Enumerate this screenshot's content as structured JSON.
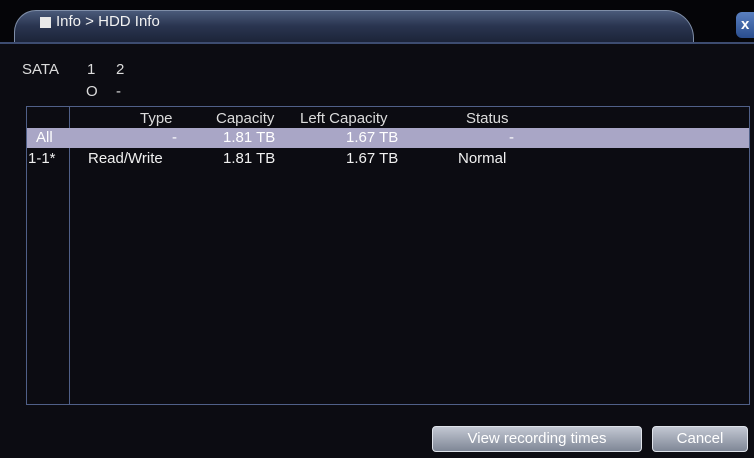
{
  "titlebar": {
    "breadcrumb": "Info > HDD Info",
    "close_glyph": "x"
  },
  "sata": {
    "label": "SATA",
    "ports": [
      {
        "number": "1",
        "state": "O"
      },
      {
        "number": "2",
        "state": "-"
      }
    ]
  },
  "table": {
    "columns": [
      "Type",
      "Capacity",
      "Left Capacity",
      "Status"
    ],
    "rows": [
      {
        "id": "All",
        "type": "-",
        "capacity": "1.81 TB",
        "left_capacity": "1.67 TB",
        "status": "-",
        "selected": true
      },
      {
        "id": "1-1*",
        "type": "Read/Write",
        "capacity": "1.81 TB",
        "left_capacity": "1.67 TB",
        "status": "Normal",
        "selected": false
      }
    ]
  },
  "buttons": {
    "view_recording_times": "View recording times",
    "cancel": "Cancel"
  },
  "colors": {
    "background": "#0c0c12",
    "selection": "#a9a6c6",
    "border": "#506088"
  }
}
